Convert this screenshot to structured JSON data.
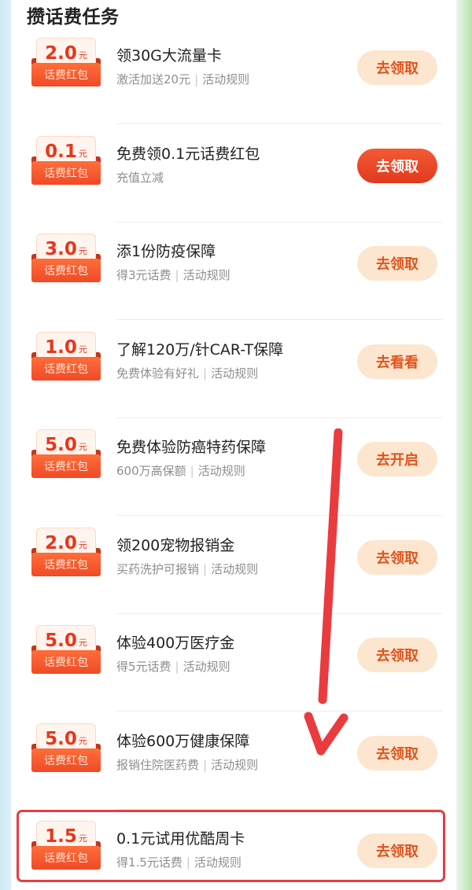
{
  "section_title": "攒话费任务",
  "badge_unit": "元",
  "badge_label": "话费红包",
  "separator": "|",
  "tasks": [
    {
      "amount": "2.0",
      "title": "领30G大流量卡",
      "desc": "激活加送20元",
      "rule": "活动规则",
      "button": "去领取",
      "button_style": "light"
    },
    {
      "amount": "0.1",
      "title": "免费领0.1元话费红包",
      "desc": "充值立减",
      "rule": "",
      "button": "去领取",
      "button_style": "primary"
    },
    {
      "amount": "3.0",
      "title": "添1份防疫保障",
      "desc": "得3元话费",
      "rule": "活动规则",
      "button": "去领取",
      "button_style": "light"
    },
    {
      "amount": "1.0",
      "title": "了解120万/针CAR-T保障",
      "desc": "免费体验有好礼",
      "rule": "活动规则",
      "button": "去看看",
      "button_style": "light"
    },
    {
      "amount": "5.0",
      "title": "免费体验防癌特药保障",
      "desc": "600万高保额",
      "rule": "活动规则",
      "button": "去开启",
      "button_style": "light"
    },
    {
      "amount": "2.0",
      "title": "领200宠物报销金",
      "desc": "买药洗护可报销",
      "rule": "活动规则",
      "button": "去领取",
      "button_style": "light"
    },
    {
      "amount": "5.0",
      "title": "体验400万医疗金",
      "desc": "得5元话费",
      "rule": "活动规则",
      "button": "去领取",
      "button_style": "light"
    },
    {
      "amount": "5.0",
      "title": "体验600万健康保障",
      "desc": "报销住院医药费",
      "rule": "活动规则",
      "button": "去领取",
      "button_style": "light"
    },
    {
      "amount": "1.5",
      "title": "0.1元试用优酷周卡",
      "desc": "得1.5元话费",
      "rule": "活动规则",
      "button": "去领取",
      "button_style": "light"
    }
  ],
  "colors": {
    "accent_red": "#e8361d",
    "button_light_bg": "#fde6cf",
    "button_light_text": "#e0541f",
    "annotation_red": "#ea3b3f"
  },
  "annotations": {
    "arrow": "red-down-arrow",
    "highlight_target": "tasks.8"
  }
}
